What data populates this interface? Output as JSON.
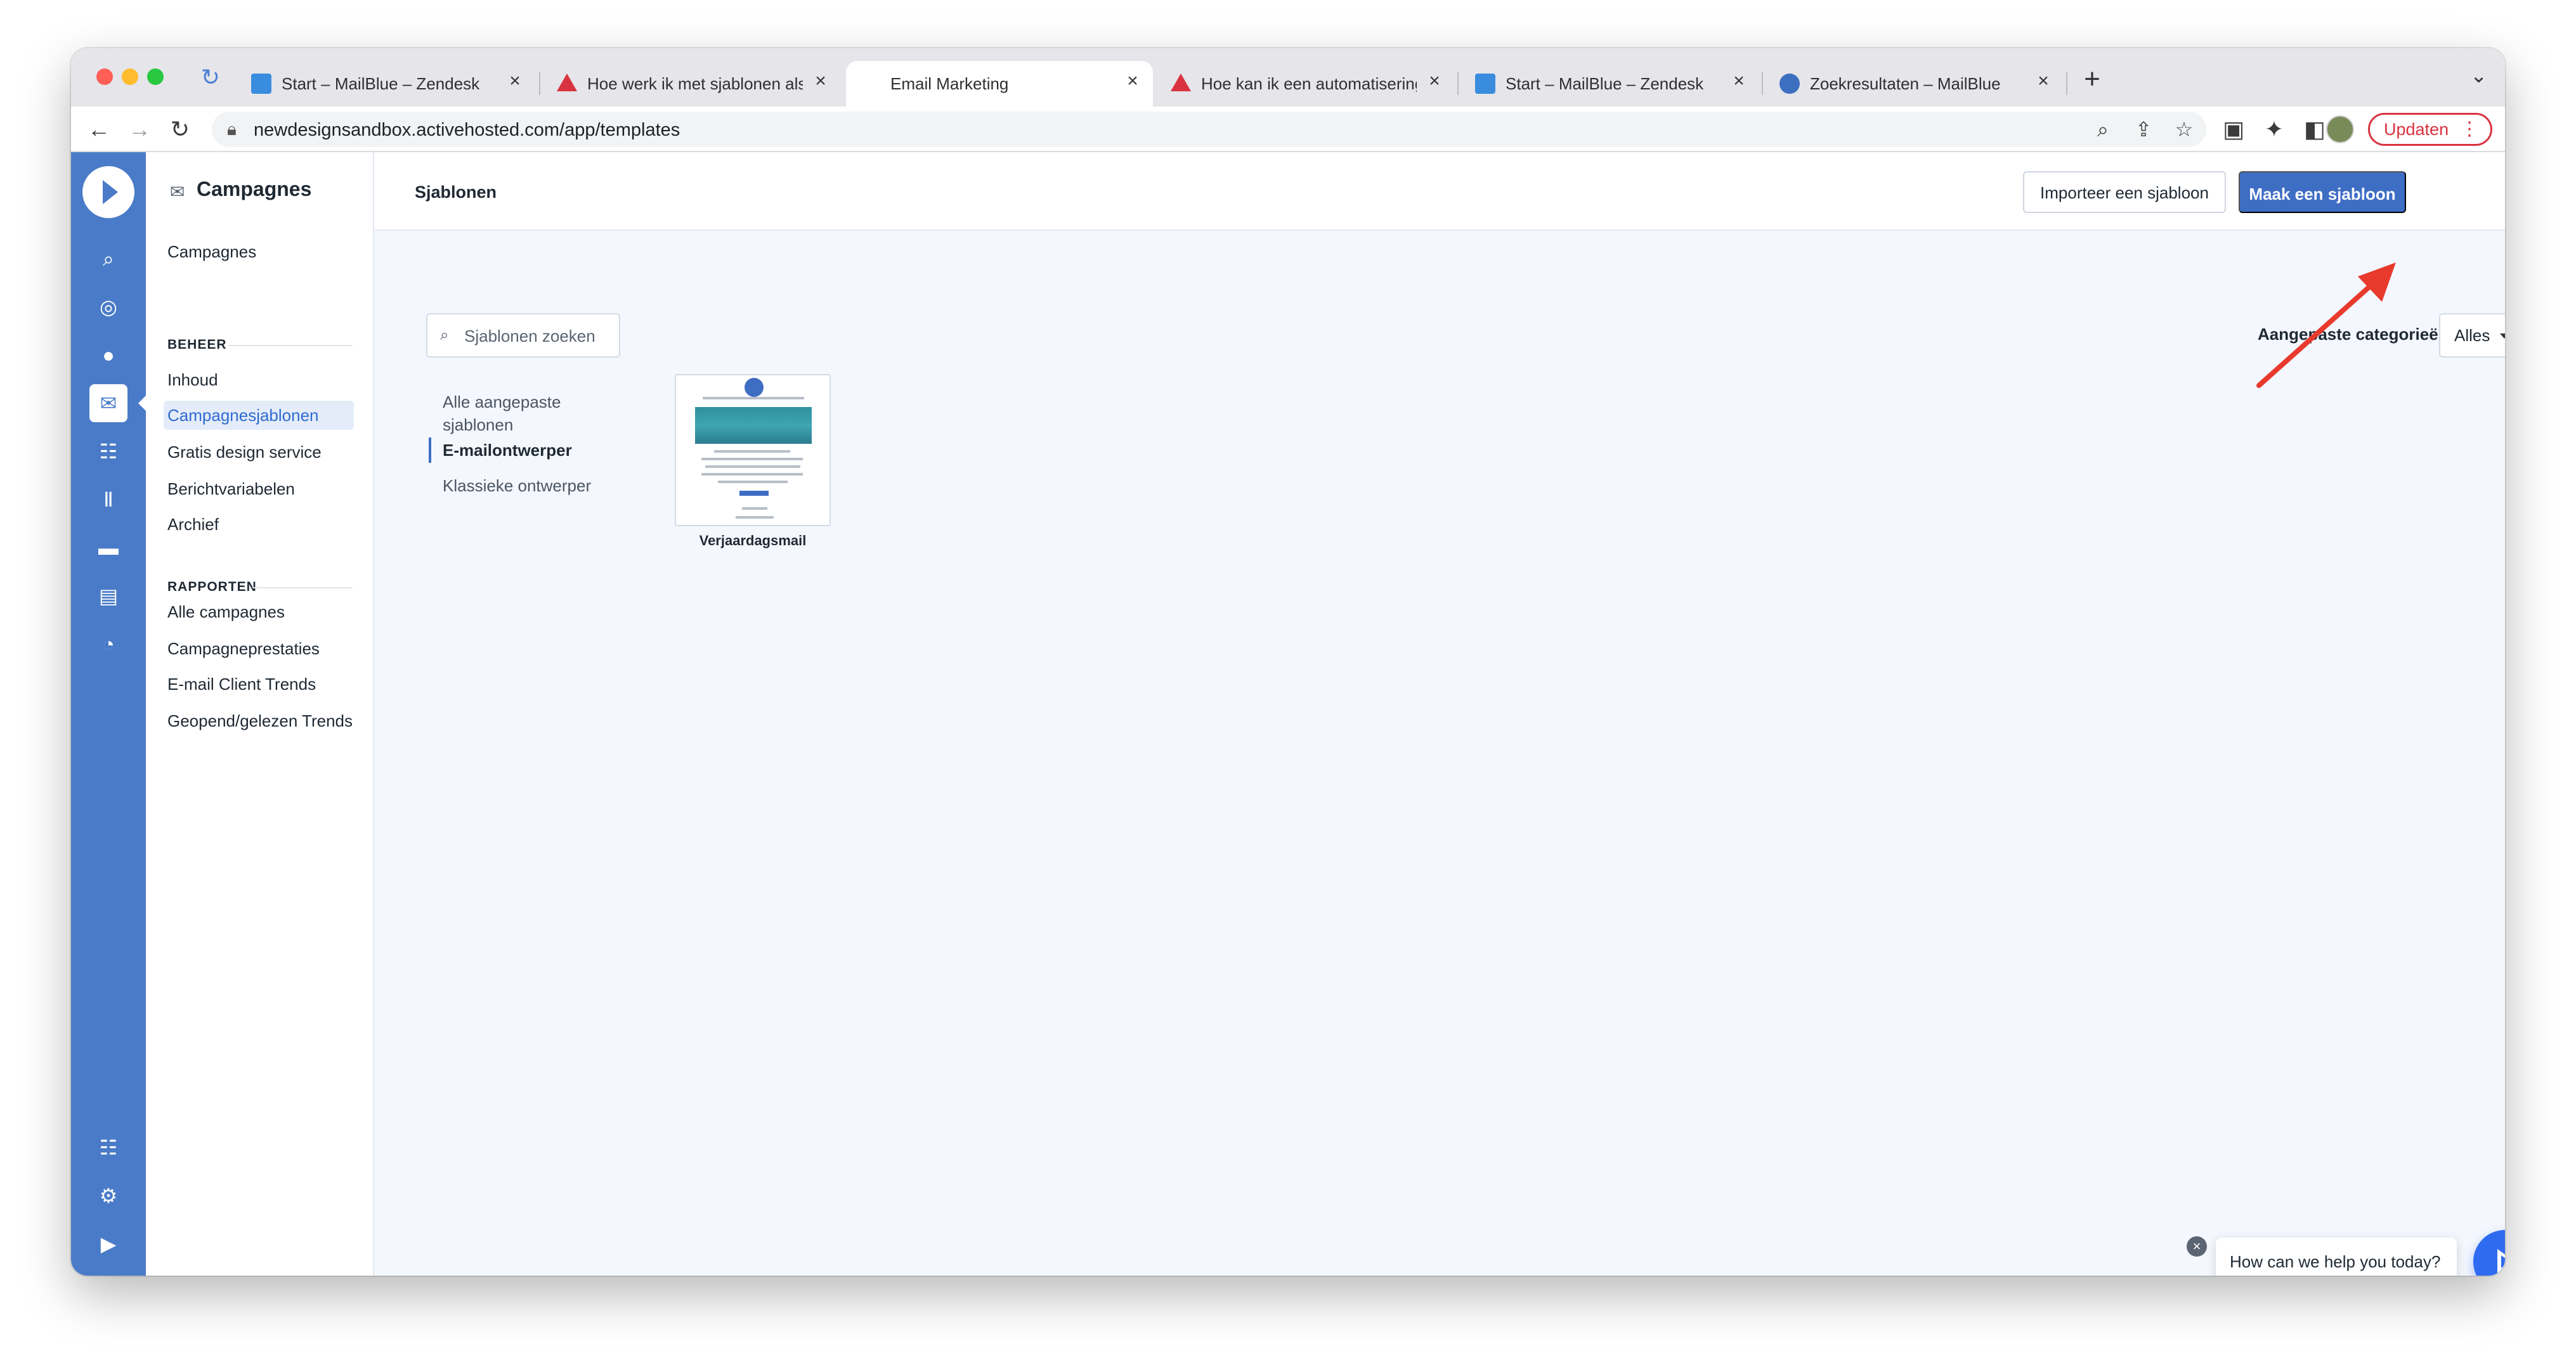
{
  "browser": {
    "tabs": [
      {
        "title": "Start – MailBlue – Zendesk",
        "icon": "zendesk-icon",
        "active": false
      },
      {
        "title": "Hoe werk ik met sjablonen als",
        "icon": "warning-triangle-icon",
        "active": false
      },
      {
        "title": "Email Marketing",
        "icon": "",
        "active": true
      },
      {
        "title": "Hoe kan ik een automatisering",
        "icon": "warning-triangle-icon",
        "active": false
      },
      {
        "title": "Start – MailBlue – Zendesk",
        "icon": "zendesk-icon",
        "active": false
      },
      {
        "title": "Zoekresultaten – MailBlue",
        "icon": "mailblue-icon",
        "active": false
      }
    ],
    "url": "newdesignsandbox.activehosted.com/app/templates",
    "update_label": "Updaten",
    "close_glyph": "×",
    "new_tab_glyph": "+"
  },
  "subnav": {
    "title": "Campagnes",
    "top_item": "Campagnes",
    "beheer_label": "BEHEER",
    "beheer_items": [
      "Inhoud",
      "Campagnesjablonen",
      "Gratis design service",
      "Berichtvariabelen",
      "Archief"
    ],
    "active_item": "Campagnesjablonen",
    "rapporten_label": "RAPPORTEN",
    "rapporten_items": [
      "Alle campagnes",
      "Campagneprestaties",
      "E-mail Client Trends",
      "Geopend/gelezen Trends"
    ]
  },
  "rail": {
    "icons": [
      "search-icon",
      "lightbulb-icon",
      "contacts-icon",
      "campaigns-icon",
      "automations-icon",
      "deals-icon",
      "conversations-icon",
      "website-icon",
      "reports-icon",
      "apps-icon",
      "settings-icon",
      "help-icon"
    ],
    "active_icon": "campaigns-icon"
  },
  "main": {
    "page_title": "Sjablonen",
    "import_button": "Importeer een sjabloon",
    "create_button": "Maak een sjabloon",
    "search_placeholder": "Sjablonen zoeken",
    "category_label": "Aangepaste categorieën",
    "category_value": "Alles",
    "filters": [
      "Alle aangepaste sjablonen",
      "E-mailontwerper",
      "Klassieke ontwerper"
    ],
    "active_filter": "E-mailontwerper",
    "templates": [
      {
        "name": "Verjaardagsmail"
      }
    ]
  },
  "chat": {
    "prompt": "How can we help you today?"
  },
  "colors": {
    "brand_blue": "#4a7bc8",
    "primary_button": "#3e6dc4",
    "annotation_arrow": "#e8392d",
    "update_red": "#d9333f"
  }
}
